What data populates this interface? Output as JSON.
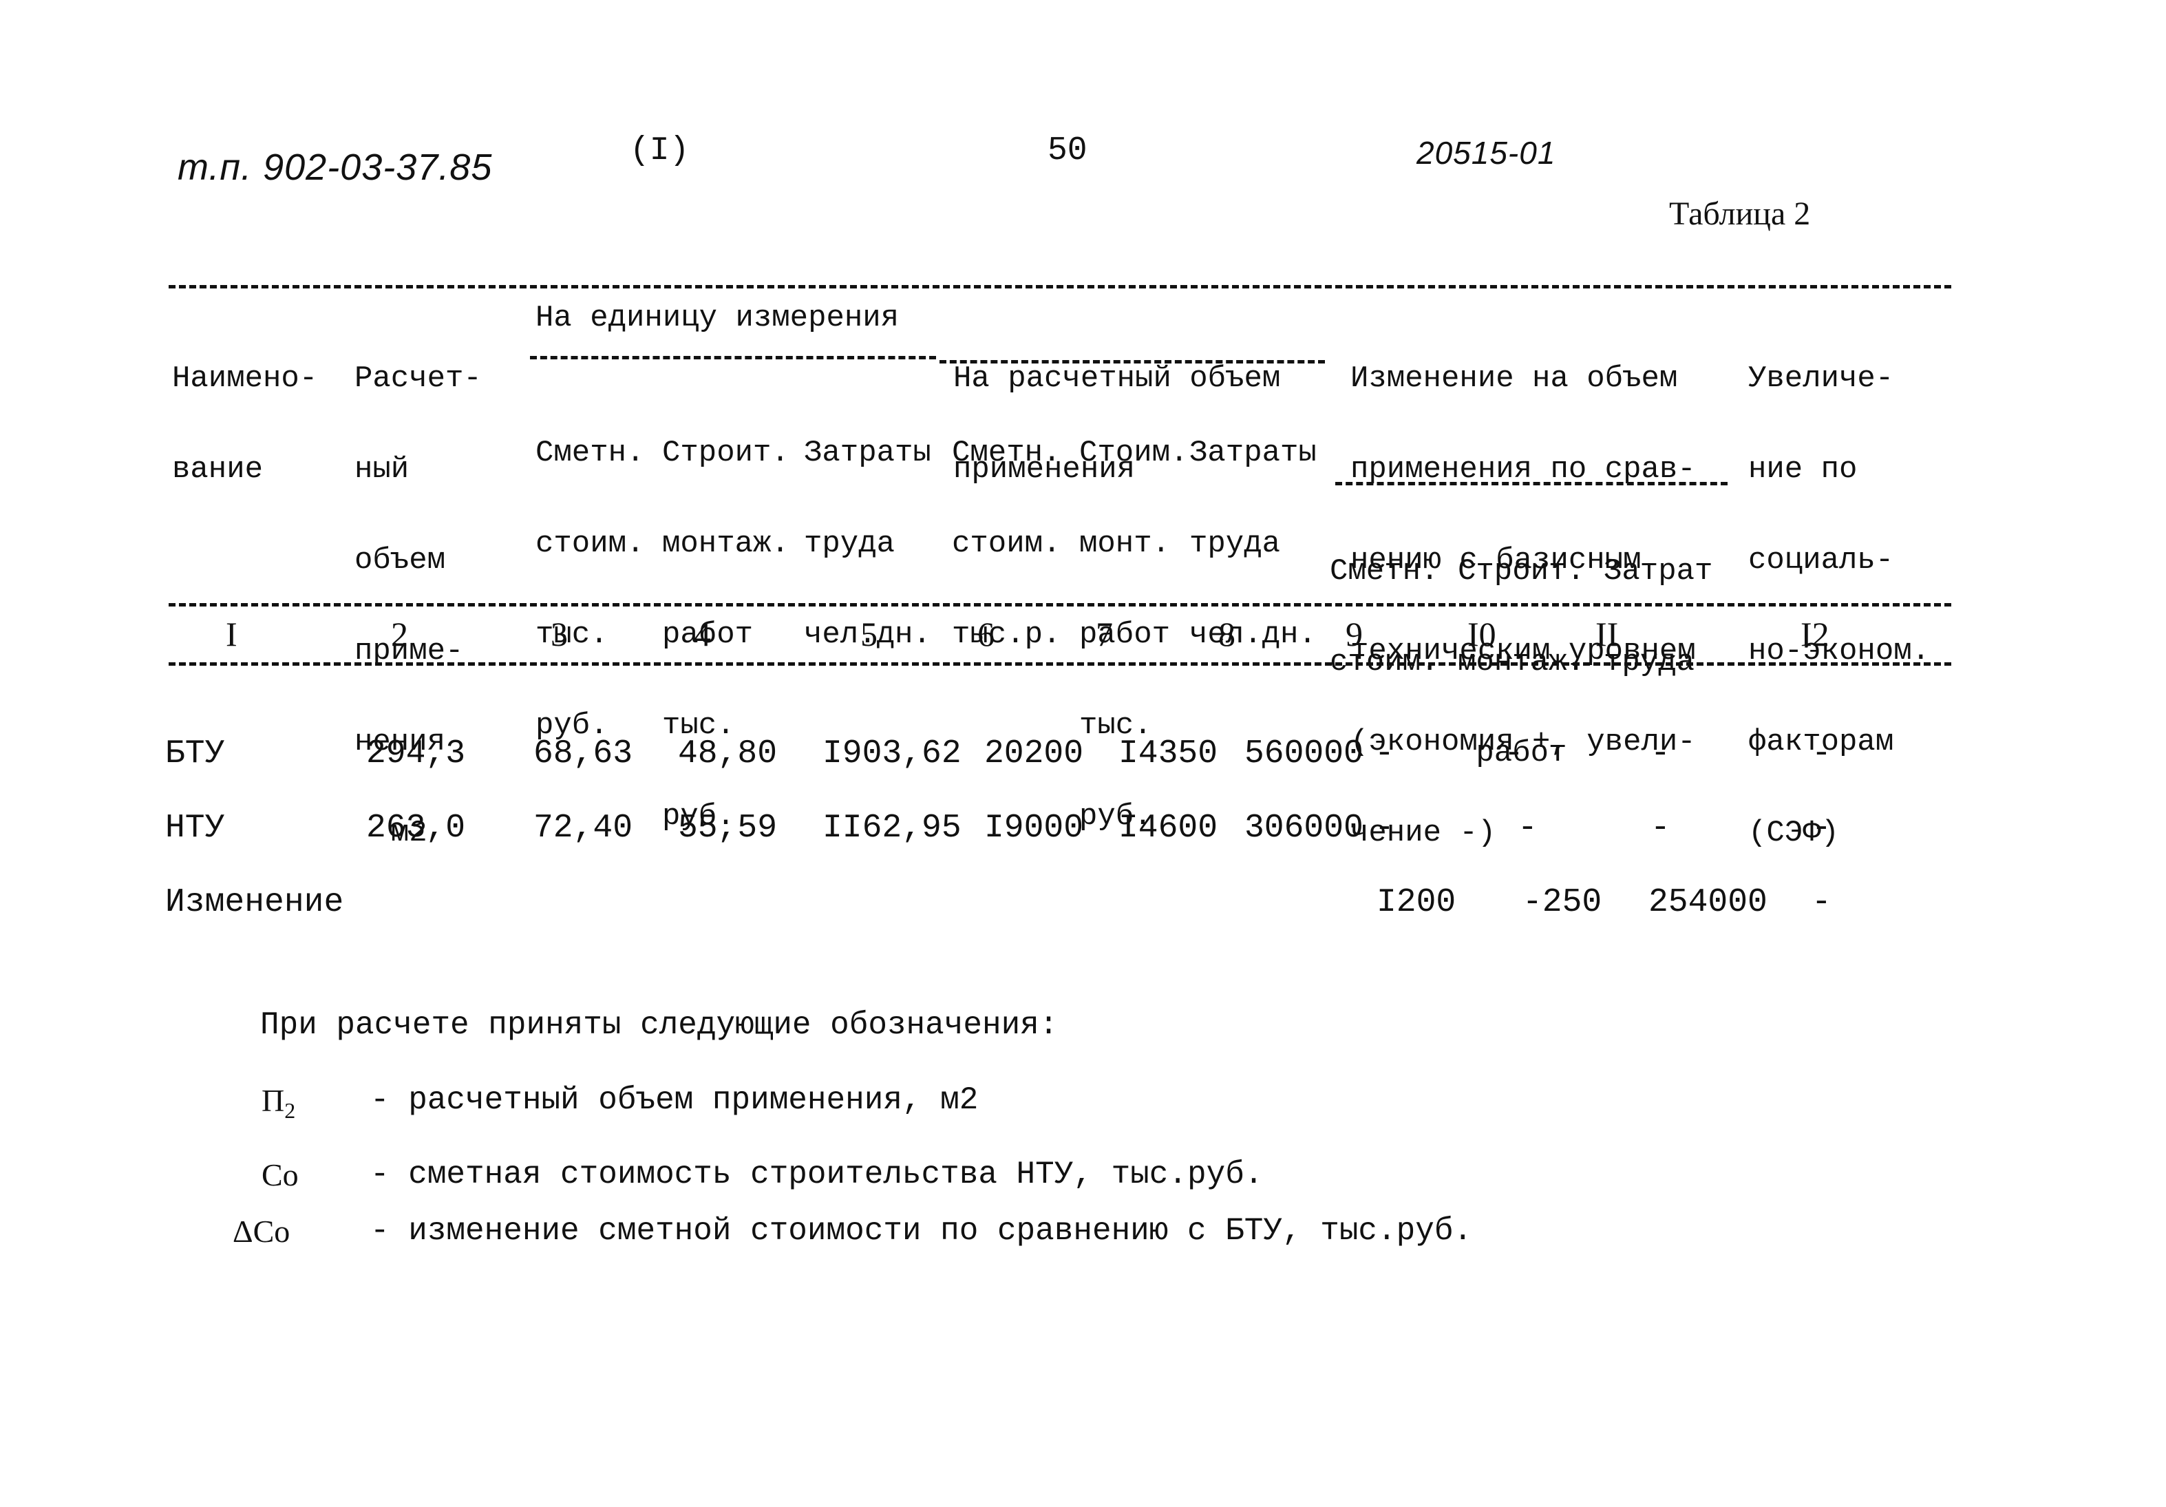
{
  "header": {
    "doc_code": "т.п. 902-03-37.85",
    "part": "(I)",
    "page_number": "50",
    "inventory_number": "20515-01",
    "table_title": "Таблица 2"
  },
  "table": {
    "group_headers": {
      "per_unit": "На единицу измерения",
      "per_volume": [
        "На расчетный объем",
        "применения"
      ],
      "change": [
        "Изменение на объем",
        "применения по срав-",
        "нению с базисным",
        "техническим уровнем",
        "(экономия +, увели-",
        "чение -)"
      ]
    },
    "columns": [
      {
        "num": "I",
        "label": [
          "Наимено-",
          "вание"
        ]
      },
      {
        "num": "2",
        "label": [
          "Расчет-",
          "ный",
          "объем",
          "приме-",
          "нения",
          "  м2"
        ]
      },
      {
        "num": "3",
        "label": [
          "Сметн.",
          "стоим.",
          "тыс.",
          "руб."
        ]
      },
      {
        "num": "4",
        "label": [
          "Строит.",
          "монтаж.",
          "работ",
          "тыс.",
          "руб."
        ]
      },
      {
        "num": "5",
        "label": [
          "Затраты",
          "труда",
          "чел.дн."
        ]
      },
      {
        "num": "6",
        "label": [
          "Сметн.",
          "стоим.",
          "тыс.р."
        ]
      },
      {
        "num": "7",
        "label": [
          "Стоим.",
          "монт.",
          "работ",
          "тыс.",
          "руб."
        ]
      },
      {
        "num": "8",
        "label": [
          "Затраты",
          "труда",
          "чел.дн."
        ]
      },
      {
        "num": "9",
        "label": [
          "Сметн.",
          "стоим."
        ]
      },
      {
        "num": "I0",
        "label": [
          "Строит.",
          "монтаж.",
          "работ"
        ]
      },
      {
        "num": "II",
        "label": [
          "Затрат",
          "труда"
        ]
      },
      {
        "num": "I2",
        "label": [
          "Увеличе-",
          "ние по",
          "социаль-",
          "но-эконом.",
          "факторам",
          "(СЭФ)"
        ]
      }
    ],
    "rows": [
      {
        "name": "БТУ",
        "cells": [
          "294,3",
          "68,63",
          "48,80",
          "I903,62",
          "20200",
          "I4350",
          "560000",
          "-",
          "-",
          "-",
          "-"
        ]
      },
      {
        "name": "НТУ",
        "cells": [
          "263,0",
          "72,40",
          "55,59",
          "II62,95",
          "I9000",
          "I4600",
          "306000",
          "-",
          "-",
          "-",
          "-"
        ]
      },
      {
        "name": "Изменение",
        "cells": [
          "",
          "",
          "",
          "",
          "",
          "",
          "",
          "I200",
          "-250",
          "254000",
          "-"
        ]
      }
    ]
  },
  "legend": {
    "intro": "При расчете приняты следующие обозначения:",
    "items": [
      {
        "symbol": "П",
        "sub": "2",
        "text": "- расчетный объем применения, м2"
      },
      {
        "symbol": "Со",
        "sub": "",
        "text": "- сметная стоимость строительства НТУ, тыс.руб."
      },
      {
        "symbol": "ΔСо",
        "sub": "",
        "text": "- изменение сметной стоимости по сравнению с БТУ, тыс.руб."
      }
    ]
  }
}
